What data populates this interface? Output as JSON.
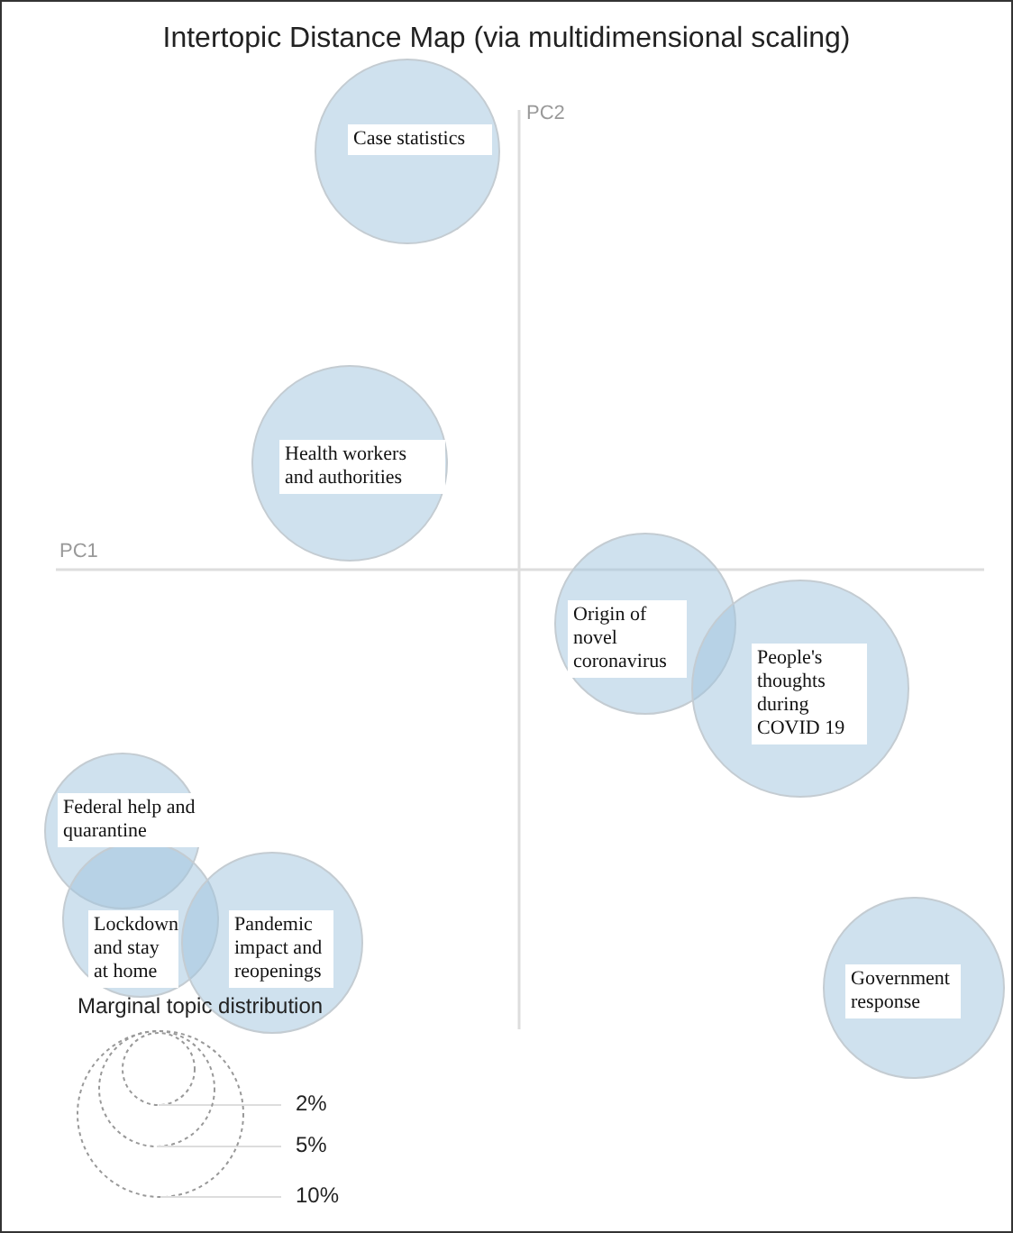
{
  "title": "Intertopic Distance Map (via multidimensional scaling)",
  "axes": {
    "x_label": "PC1",
    "y_label": "PC2"
  },
  "topics": [
    {
      "label": "Case statistics"
    },
    {
      "label": "Health workers and authorities"
    },
    {
      "label": "Origin of novel coronavirus"
    },
    {
      "label": "People's thoughts during COVID 19"
    },
    {
      "label": "Federal help and quarantine"
    },
    {
      "label": "Lockdown and stay at home"
    },
    {
      "label": "Pandemic impact and reopenings"
    },
    {
      "label": "Government response"
    }
  ],
  "legend": {
    "title": "Marginal topic distribution",
    "sizes": [
      "2%",
      "5%",
      "10%"
    ]
  }
}
